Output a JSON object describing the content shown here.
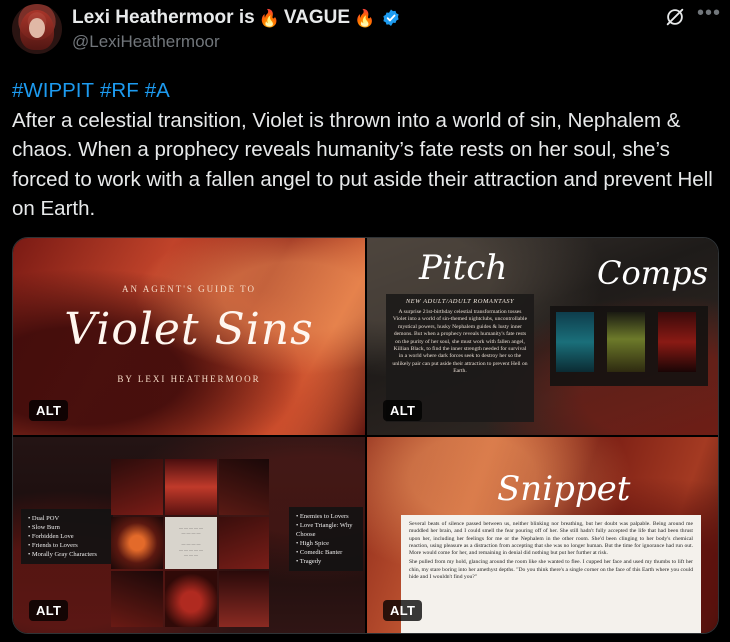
{
  "author": {
    "display_name": "Lexi Heathermoor is",
    "emoji_left": "🔥",
    "name_suffix": "VAGUE",
    "emoji_right": "🔥",
    "handle": "@LexiHeathermoor",
    "verified": true
  },
  "post": {
    "hashtags": [
      "#WIPPIT",
      "#RF",
      "#A"
    ],
    "text": "After a celestial transition, Violet is thrown into a world of sin, Nephalem & chaos. When a prophecy reveals humanity’s fate rests on her soul, she’s forced to work with a fallen angel to put aside their attraction and prevent Hell on Earth."
  },
  "actions": {
    "grok_icon": "grok-icon",
    "more_icon": "more-icon"
  },
  "media": {
    "alt_label": "ALT",
    "tile1": {
      "kicker": "AN AGENT'S GUIDE TO",
      "title": "Violet Sins",
      "byline": "BY LEXI HEATHERMOOR"
    },
    "tile2": {
      "pitch_title": "Pitch",
      "comps_title": "Comps",
      "pitch_subtitle": "NEW ADULT/ADULT ROMANTASY",
      "pitch_body": "A surprise 21st-birthday celestial transformation tosses Violet into a world of sin-themed nightclubs, uncontrollable mystical powers, husky Nephalem guides & lusty inner demons. But when a prophecy reveals humanity's fate rests on the purity of her soul, she must work with fallen angel, Killian Black, to find the inner strength needed for survival in a world where dark forces seek to destroy her so the unlikely pair can put aside their attraction to prevent Hell on Earth."
    },
    "tile3": {
      "left_list": [
        "Dual POV",
        "Slow Burn",
        "Forbidden Love",
        "Friends to Lovers",
        "Morally Gray Characters"
      ],
      "right_list": [
        "Enemies to Lovers",
        "Love Triangle: Why Choose",
        "High Spice",
        "Comedic Banter",
        "Tragedy"
      ]
    },
    "tile4": {
      "snippet_title": "Snippet",
      "paragraphs": [
        "Several beats of silence passed between us, neither blinking nor breathing, but her doubt was palpable. Being around me muddled her brain, and I could smell the fear pouring off of her. She still hadn't fully accepted the life that had been thrust upon her, including her feelings for me or the Nephalem in the other room. She'd been clinging to her body's chemical reaction, using pleasure as a distraction from accepting that she was no longer human. But the time for ignorance had run out. More would come for her, and remaining in denial did nothing but put her further at risk.",
        "She pulled from my hold, glancing around the room like she wanted to flee. I cupped her face and used my thumbs to lift her chin, my stare boring into her amethyst depths. \"Do you think there's a single corner on the face of this Earth where you could hide and I wouldn't find you?\""
      ]
    }
  },
  "colors": {
    "background": "#000000",
    "text": "#e7e9ea",
    "secondary_text": "#71767b",
    "hashtag": "#1d9bf0",
    "verified": "#1d9bf0"
  }
}
